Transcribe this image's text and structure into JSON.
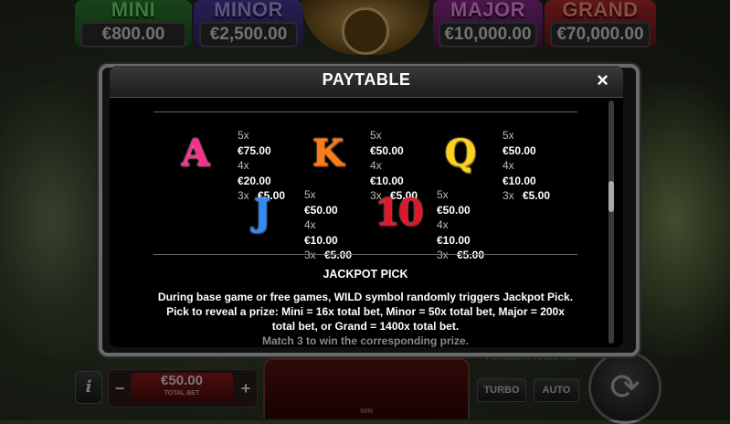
{
  "jackpots": {
    "mini": {
      "name": "MINI",
      "value": "€800.00"
    },
    "minor": {
      "name": "MINOR",
      "value": "€2,500.00"
    },
    "major": {
      "name": "MAJOR",
      "value": "€10,000.00"
    },
    "grand": {
      "name": "GRAND",
      "value": "€70,000.00"
    }
  },
  "paytable": {
    "title": "PAYTABLE",
    "close_icon": "×",
    "symbols_row1": [
      {
        "symbol": "A",
        "pays": [
          {
            "mult": "5x",
            "amount": "€75.00"
          },
          {
            "mult": "4x",
            "amount": "€20.00"
          },
          {
            "mult": "3x",
            "amount": "€5.00"
          }
        ]
      },
      {
        "symbol": "K",
        "pays": [
          {
            "mult": "5x",
            "amount": "€50.00"
          },
          {
            "mult": "4x",
            "amount": "€10.00"
          },
          {
            "mult": "3x",
            "amount": "€5.00"
          }
        ]
      },
      {
        "symbol": "Q",
        "pays": [
          {
            "mult": "5x",
            "amount": "€50.00"
          },
          {
            "mult": "4x",
            "amount": "€10.00"
          },
          {
            "mult": "3x",
            "amount": "€5.00"
          }
        ]
      }
    ],
    "symbols_row2": [
      {
        "symbol": "J",
        "pays": [
          {
            "mult": "5x",
            "amount": "€50.00"
          },
          {
            "mult": "4x",
            "amount": "€10.00"
          },
          {
            "mult": "3x",
            "amount": "€5.00"
          }
        ]
      },
      {
        "symbol": "10",
        "pays": [
          {
            "mult": "5x",
            "amount": "€50.00"
          },
          {
            "mult": "4x",
            "amount": "€10.00"
          },
          {
            "mult": "3x",
            "amount": "€5.00"
          }
        ]
      }
    ],
    "jackpot_pick_heading": "JACKPOT PICK",
    "jackpot_pick_lines": [
      "During base game or free games, WILD symbol randomly triggers Jackpot Pick.",
      "Pick to reveal a prize: Mini = 16x total bet, Minor = 50x total bet, Major = 200x",
      "total bet, or Grand = 1400x total bet.",
      "Match 3 to win the corresponding prize."
    ]
  },
  "controls": {
    "info_label": "i",
    "bet_value": "€50.00",
    "bet_label": "TOTAL BET",
    "minus": "−",
    "plus": "+",
    "win_label": "WIN",
    "note": "FREE GAMES IN THE BASE GAME",
    "turbo": "TURBO",
    "auto": "AUTO",
    "spin_icon": "⟳"
  }
}
